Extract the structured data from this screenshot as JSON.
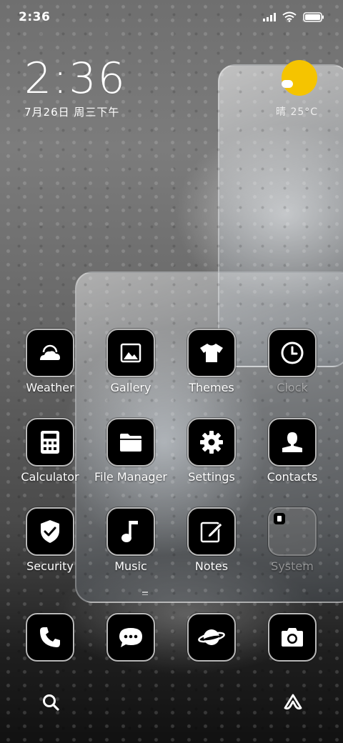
{
  "status_bar": {
    "time": "2:36"
  },
  "clock_widget": {
    "time": "2:36",
    "date": "7月26日 周三下午"
  },
  "weather_widget": {
    "temperature": "晴 25°C",
    "icon": "sunny-icon"
  },
  "apps": [
    {
      "label": "Weather",
      "icon": "weather-icon"
    },
    {
      "label": "Gallery",
      "icon": "gallery-icon"
    },
    {
      "label": "Themes",
      "icon": "tshirt-icon"
    },
    {
      "label": "Clock",
      "icon": "clock-icon"
    },
    {
      "label": "Calculator",
      "icon": "calculator-icon"
    },
    {
      "label": "File Manager",
      "icon": "folder-icon"
    },
    {
      "label": "Settings",
      "icon": "gear-icon"
    },
    {
      "label": "Contacts",
      "icon": "contact-icon"
    },
    {
      "label": "Security",
      "icon": "shield-icon"
    },
    {
      "label": "Music",
      "icon": "music-note-icon"
    },
    {
      "label": "Notes",
      "icon": "notes-icon"
    },
    {
      "label": "System",
      "icon": "system-folder-icon"
    }
  ],
  "dock": [
    {
      "label": "Phone",
      "icon": "phone-icon"
    },
    {
      "label": "Messages",
      "icon": "chat-icon"
    },
    {
      "label": "Browser",
      "icon": "planet-icon"
    },
    {
      "label": "Camera",
      "icon": "camera-icon"
    }
  ],
  "bottom_bar": {
    "left_icon": "search-icon",
    "right_icon": "launcher-icon"
  },
  "colors": {
    "icon_bg": "#000000",
    "icon_border": "#b9b9b9",
    "sun": "#f5c400"
  }
}
